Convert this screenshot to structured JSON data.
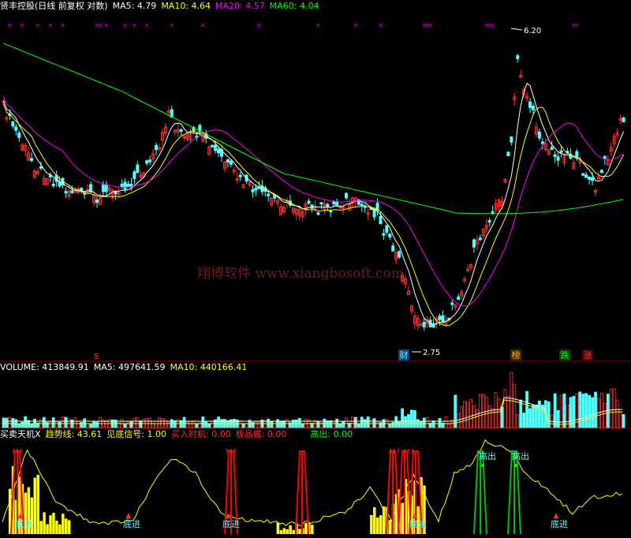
{
  "colors": {
    "bg": "#000000",
    "up": "#ff3232",
    "down": "#54ffff",
    "ma5": "#ffffff",
    "ma10": "#ffff00",
    "ma20": "#ff00ff",
    "ma60": "#00ff00",
    "yellow": "#ffff00",
    "purple": "#d000d0",
    "grid": "#8b0000",
    "label_cyan": "#54ffff"
  },
  "header": {
    "title": "贤丰控股(日线 前复权 对数)",
    "ma5_label": "MA5:",
    "ma5_value": "4.79",
    "ma10_label": "MA10:",
    "ma10_value": "4.64",
    "ma20_label": "MA20:",
    "ma20_value": "4.57",
    "ma60_label": "MA60:",
    "ma60_value": "4.04"
  },
  "markers": {
    "high_label": "6.20",
    "low_label": "2.75",
    "s_label": "S",
    "cai": "财",
    "bang": "榜",
    "die": "跌",
    "zhang": "涨",
    "x_symbol": "×"
  },
  "watermark": "翔博软件 www.xiangbosoft.com",
  "volume_header": {
    "vol_label": "VOLUME:",
    "vol_value": "413849.91",
    "ma5_label": "MA5:",
    "ma5_value": "497641.59",
    "ma10_label": "MA10:",
    "ma10_value": "440166.41"
  },
  "indicator_header": {
    "name": "买卖天机X",
    "trend_label": "趋势线:",
    "trend_value": "43.61",
    "bottom_label": "见底信号:",
    "bottom_value": "1.00",
    "buy_label": "买入时机:",
    "buy_value": "0.00",
    "extreme_label": "极品底:",
    "extreme_value": "0.00",
    "high_label": "高出:",
    "high_value": "0.00"
  },
  "signals": {
    "buy": "底进",
    "sell": "高出"
  },
  "chart_data": {
    "type": "candlestick",
    "price_range": [
      2.5,
      6.4
    ],
    "high": 6.2,
    "low": 2.75,
    "x_marks": [
      2,
      6,
      11,
      15,
      19,
      30,
      31,
      33,
      39,
      42,
      46,
      54,
      64,
      82,
      101,
      113,
      121,
      135,
      136,
      137,
      155,
      156,
      157,
      183,
      184
    ]
  }
}
